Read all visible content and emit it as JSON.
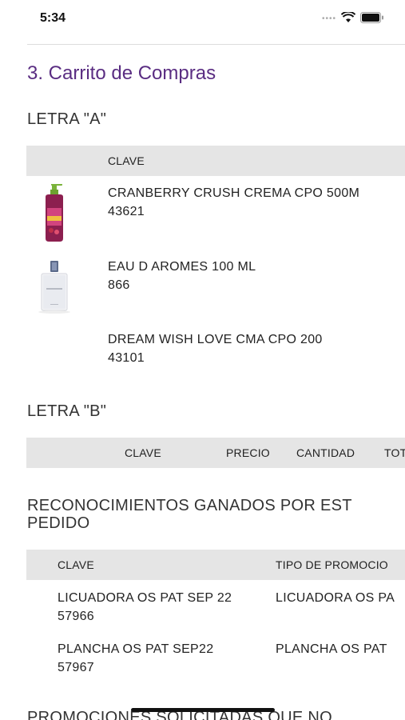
{
  "status_bar": {
    "time": "5:34"
  },
  "cart": {
    "title": "3. Carrito de Compras",
    "letter_a": {
      "heading": "LETRA \"A\"",
      "column_header": "CLAVE",
      "items": [
        {
          "name": "CRANBERRY CRUSH CREMA CPO 500M",
          "code": "43621",
          "image": "lotion-bottle"
        },
        {
          "name": "EAU D AROMES 100 ML",
          "code": "866",
          "image": "perfume-bottle"
        },
        {
          "name": "DREAM WISH LOVE CMA CPO 200",
          "code": "43101",
          "image": ""
        }
      ]
    },
    "letter_b": {
      "heading": "LETRA \"B\"",
      "columns": [
        "CLAVE",
        "PRECIO",
        "CANTIDAD",
        "TOT"
      ]
    },
    "rewards": {
      "heading_line1": "RECONOCIMIENTOS GANADOS POR EST",
      "heading_line2": "PEDIDO",
      "columns": [
        "CLAVE",
        "TIPO DE PROMOCIO"
      ],
      "rows": [
        {
          "name": "LICUADORA OS PAT SEP 22",
          "code": "57966",
          "promo": "LICUADORA OS PA"
        },
        {
          "name": "PLANCHA OS PAT SEP22",
          "code": "57967",
          "promo": "PLANCHA OS PAT"
        }
      ]
    },
    "next_section_heading": "PROMOCIONES SOLICITADAS QUE NO"
  }
}
